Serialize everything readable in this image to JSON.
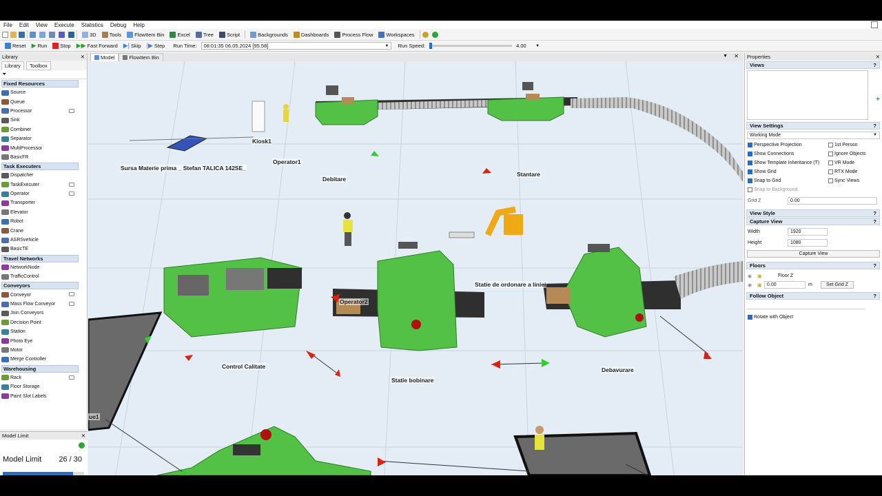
{
  "menu": {
    "items": [
      "File",
      "Edit",
      "View",
      "Execute",
      "Statistics",
      "Debug",
      "Help"
    ]
  },
  "toolbar": {
    "items": [
      {
        "label": "3D",
        "icon": "3d-view-icon"
      },
      {
        "label": "Tools",
        "icon": "tools-icon"
      },
      {
        "label": "FlowItem Bin",
        "icon": "flowitem-bin-icon"
      },
      {
        "label": "Excel",
        "icon": "excel-icon"
      },
      {
        "label": "Tree",
        "icon": "tree-icon"
      },
      {
        "label": "Script",
        "icon": "script-icon"
      },
      {
        "label": "Backgrounds",
        "icon": "backgrounds-icon"
      },
      {
        "label": "Dashboards",
        "icon": "dashboards-icon"
      },
      {
        "label": "Process Flow",
        "icon": "process-flow-icon"
      },
      {
        "label": "Workspaces",
        "icon": "workspaces-icon"
      }
    ]
  },
  "runbar": {
    "reset": "Reset",
    "run": "Run",
    "stop": "Stop",
    "fast_forward": "Fast Forward",
    "skip": "Skip",
    "step": "Step",
    "run_time_label": "Run Time:",
    "run_time_value": "08:01:35  06.05.2024  [95.58]",
    "run_speed_label": "Run Speed:",
    "run_speed_value": "4.00"
  },
  "library": {
    "title": "Library",
    "tab_library": "Library",
    "tab_toolbox": "Toolbox",
    "sections": [
      {
        "title": "Fixed Resources",
        "items": [
          "Source",
          "Queue",
          "Processor",
          "Sink",
          "Combiner",
          "Separator",
          "MultiProcessor",
          "BasicFR"
        ]
      },
      {
        "title": "Task Executers",
        "items": [
          "Dispatcher",
          "TaskExecuter",
          "Operator",
          "Transporter",
          "Elevator",
          "Robot",
          "Crane",
          "ASRSvehicle",
          "BasicTE"
        ]
      },
      {
        "title": "Travel Networks",
        "items": [
          "NetworkNode",
          "TrafficControl"
        ]
      },
      {
        "title": "Conveyors",
        "items": [
          "Conveyor",
          "Mass Flow Conveyor",
          "Join Conveyors",
          "Decision Point",
          "Station",
          "Photo Eye",
          "Motor",
          "Merge Controller"
        ]
      },
      {
        "title": "Warehousing",
        "items": [
          "Rack",
          "Floor Storage",
          "Paint Slot Labels"
        ]
      }
    ]
  },
  "model_limit": {
    "title": "Model Limit",
    "label": "Model Limit",
    "value": "26 / 30",
    "progress": 0.8667
  },
  "view_tabs": [
    "Model",
    "FlowItem Bin"
  ],
  "scene_labels": {
    "kiosk": "Kiosk1",
    "operator1": "Operator1",
    "source": "Sursa Materie prima _ Stefan TALICA 142SE_",
    "debitare": "Debitare",
    "stantare": "Stantare",
    "ordonare": "Statie de ordonare a liniei",
    "operator2": "Operator2",
    "control": "Control Calitate",
    "bobinare": "Statie bobinare",
    "debavurare": "Debavurare",
    "queue": "ue1"
  },
  "properties": {
    "title": "Properties",
    "views_title": "Views",
    "view_settings_title": "View Settings",
    "working_mode": "Working Mode",
    "options": [
      {
        "label": "Perspective Projection",
        "checked": true
      },
      {
        "label": "1st Person",
        "checked": false
      },
      {
        "label": "Show Connections",
        "checked": true
      },
      {
        "label": "Ignore Objects",
        "checked": false
      },
      {
        "label": "Show Template Inheritance (T)",
        "checked": true
      },
      {
        "label": "VR Mode",
        "checked": false
      },
      {
        "label": "Show Grid",
        "checked": true
      },
      {
        "label": "RTX Mode",
        "checked": false
      },
      {
        "label": "Snap to Grid",
        "checked": true
      },
      {
        "label": "Sync Views",
        "checked": false
      }
    ],
    "snap_bg": "Snap to Background",
    "grid_z_label": "Grid Z",
    "grid_z_value": "0.00",
    "view_style_title": "View Style",
    "capture_title": "Capture View",
    "width_label": "Width",
    "width_value": "1920",
    "height_label": "Height",
    "height_value": "1080",
    "capture_button": "Capture View",
    "floors_title": "Floors",
    "floor_name": "Floor Z",
    "floor_value": "0.00",
    "floor_unit": "m",
    "set_grid_button": "Set Grid Z",
    "follow_title": "Follow Object",
    "rotate_label": "Rotate with Object"
  },
  "colors": {
    "accent": "#1f6fd1",
    "machine": "#52c146",
    "conveyor": "#3b3b3b",
    "grid": "#e4edf5"
  }
}
